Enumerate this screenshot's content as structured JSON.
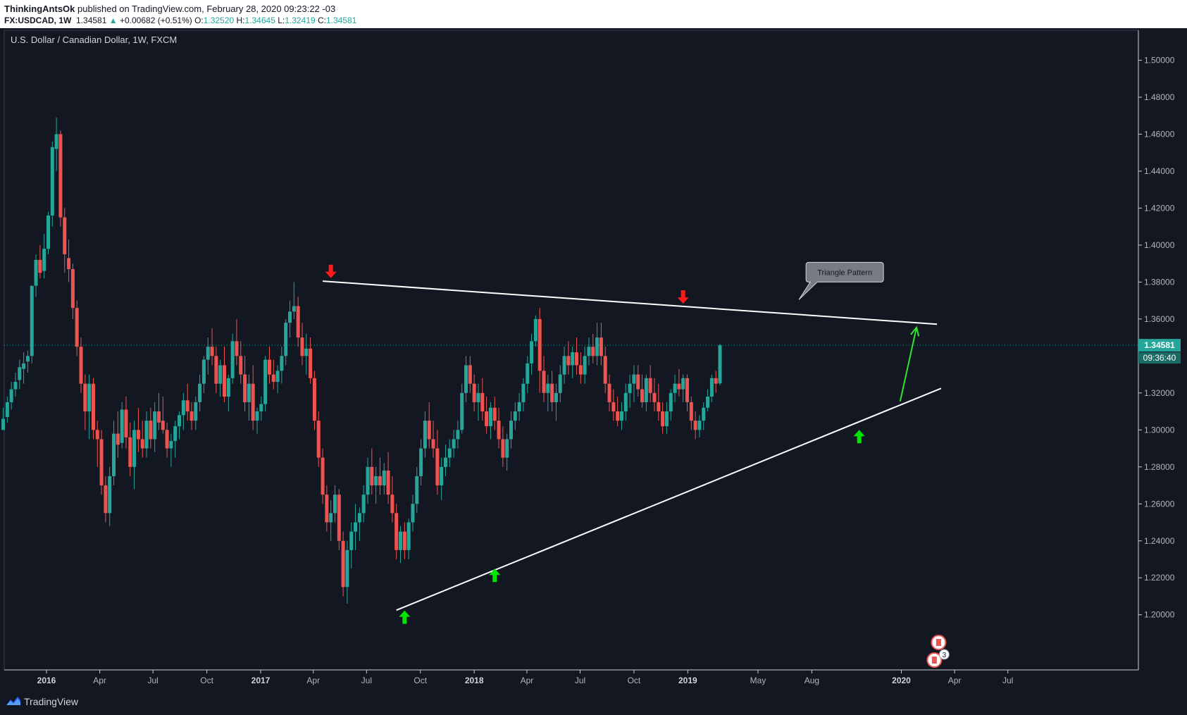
{
  "header": {
    "author": "ThinkingAntsOk",
    "published_text": "published on TradingView.com, February 28, 2020 09:23:22 -03",
    "symbol": "FX:USDCAD, 1W",
    "last": "1.34581",
    "change_arrow": "▲",
    "change": "+0.00682 (+0.51%)",
    "o_label": "O:",
    "o_value": "1.32520",
    "h_label": "H:",
    "h_value": "1.34645",
    "l_label": "L:",
    "l_value": "1.32419",
    "c_label": "C:",
    "c_value": "1.34581"
  },
  "footer": {
    "brand": "TradingView",
    "logo_icon": "tradingview-logo-icon"
  },
  "colors": {
    "background": "#131722",
    "up": "#26a69a",
    "down": "#ef5350",
    "trendline": "#ffffff",
    "target_arrow": "#2ee62e",
    "marker_up": "#00e600",
    "marker_down": "#ff1a1a",
    "axis_text": "#b2b5be"
  },
  "chart_data": {
    "type": "candlestick",
    "title": "U.S. Dollar / Canadian Dollar, 1W, FXCM",
    "ylim": [
      1.18,
      1.5
    ],
    "y_ticks": [
      "1.50000",
      "1.48000",
      "1.46000",
      "1.44000",
      "1.42000",
      "1.40000",
      "1.38000",
      "1.36000",
      "1.34000",
      "1.32000",
      "1.30000",
      "1.28000",
      "1.26000",
      "1.24000",
      "1.22000",
      "1.20000"
    ],
    "x_ticks": [
      {
        "label": "2016",
        "date": "2016-01-01",
        "bold": true
      },
      {
        "label": "Apr",
        "date": "2016-04-01"
      },
      {
        "label": "Jul",
        "date": "2016-07-01"
      },
      {
        "label": "Oct",
        "date": "2016-10-01"
      },
      {
        "label": "2017",
        "date": "2017-01-01",
        "bold": true
      },
      {
        "label": "Apr",
        "date": "2017-04-01"
      },
      {
        "label": "Jul",
        "date": "2017-07-01"
      },
      {
        "label": "Oct",
        "date": "2017-10-01"
      },
      {
        "label": "2018",
        "date": "2018-01-01",
        "bold": true
      },
      {
        "label": "Apr",
        "date": "2018-04-01"
      },
      {
        "label": "Jul",
        "date": "2018-07-01"
      },
      {
        "label": "Oct",
        "date": "2018-10-01"
      },
      {
        "label": "2019",
        "date": "2019-01-01",
        "bold": true
      },
      {
        "label": "May",
        "date": "2019-05-01"
      },
      {
        "label": "Aug",
        "date": "2019-08-01"
      },
      {
        "label": "2020",
        "date": "2020-01-01",
        "bold": true
      },
      {
        "label": "Apr",
        "date": "2020-04-01"
      },
      {
        "label": "Jul",
        "date": "2020-07-01"
      }
    ],
    "price_line": {
      "value": 1.34581,
      "label": "1.34581",
      "countdown": "09:36:40"
    },
    "annotation": {
      "text": "Triangle Pattern",
      "date": "2019-07-10",
      "price": 1.3705
    },
    "trendlines": [
      {
        "name": "upper-trendline",
        "from": {
          "date": "2017-04-17",
          "price": 1.3805
        },
        "to": {
          "date": "2020-03-02",
          "price": 1.3572
        }
      },
      {
        "name": "lower-trendline",
        "from": {
          "date": "2017-08-21",
          "price": 1.2025
        },
        "to": {
          "date": "2020-03-09",
          "price": 1.3225
        }
      }
    ],
    "target_arrow": {
      "from": {
        "date": "2019-12-30",
        "price": 1.3155
      },
      "to": {
        "date": "2020-01-27",
        "price": 1.3555
      }
    },
    "markers": [
      {
        "type": "down",
        "date": "2017-05-01",
        "price": 1.3856
      },
      {
        "type": "down",
        "date": "2018-12-24",
        "price": 1.3717
      },
      {
        "type": "up",
        "date": "2017-09-04",
        "price": 1.1989
      },
      {
        "type": "up",
        "date": "2018-02-05",
        "price": 1.2215
      },
      {
        "type": "up",
        "date": "2019-10-21",
        "price": 1.2966
      }
    ],
    "event_badge": {
      "date": "2020-02-24",
      "count": "3",
      "icon": "canada-flag-icon"
    },
    "candles_start": "2015-10-19",
    "candles_interval_days": 7,
    "candles": [
      [
        1.3,
        1.312,
        1.3,
        1.306
      ],
      [
        1.307,
        1.318,
        1.304,
        1.315
      ],
      [
        1.315,
        1.326,
        1.311,
        1.322
      ],
      [
        1.322,
        1.331,
        1.318,
        1.326
      ],
      [
        1.327,
        1.338,
        1.322,
        1.334
      ],
      [
        1.333,
        1.342,
        1.325,
        1.336
      ],
      [
        1.337,
        1.343,
        1.331,
        1.34
      ],
      [
        1.34,
        1.364,
        1.336,
        1.378
      ],
      [
        1.378,
        1.395,
        1.372,
        1.392
      ],
      [
        1.392,
        1.4,
        1.382,
        1.385
      ],
      [
        1.386,
        1.406,
        1.382,
        1.398
      ],
      [
        1.398,
        1.418,
        1.395,
        1.416
      ],
      [
        1.416,
        1.456,
        1.41,
        1.453
      ],
      [
        1.452,
        1.469,
        1.44,
        1.46
      ],
      [
        1.46,
        1.462,
        1.41,
        1.415
      ],
      [
        1.415,
        1.42,
        1.385,
        1.395
      ],
      [
        1.393,
        1.403,
        1.38,
        1.387
      ],
      [
        1.387,
        1.39,
        1.36,
        1.366
      ],
      [
        1.366,
        1.37,
        1.34,
        1.345
      ],
      [
        1.345,
        1.35,
        1.32,
        1.325
      ],
      [
        1.325,
        1.33,
        1.3,
        1.31
      ],
      [
        1.31,
        1.33,
        1.295,
        1.325
      ],
      [
        1.325,
        1.328,
        1.295,
        1.3
      ],
      [
        1.3,
        1.305,
        1.28,
        1.295
      ],
      [
        1.295,
        1.3,
        1.265,
        1.27
      ],
      [
        1.27,
        1.275,
        1.25,
        1.255
      ],
      [
        1.255,
        1.28,
        1.248,
        1.275
      ],
      [
        1.275,
        1.305,
        1.27,
        1.298
      ],
      [
        1.298,
        1.31,
        1.285,
        1.292
      ],
      [
        1.293,
        1.315,
        1.29,
        1.311
      ],
      [
        1.311,
        1.318,
        1.29,
        1.296
      ],
      [
        1.296,
        1.304,
        1.275,
        1.28
      ],
      [
        1.28,
        1.305,
        1.268,
        1.3
      ],
      [
        1.3,
        1.312,
        1.288,
        1.295
      ],
      [
        1.295,
        1.305,
        1.285,
        1.29
      ],
      [
        1.29,
        1.31,
        1.285,
        1.305
      ],
      [
        1.305,
        1.312,
        1.29,
        1.295
      ],
      [
        1.295,
        1.315,
        1.288,
        1.31
      ],
      [
        1.31,
        1.32,
        1.3,
        1.304
      ],
      [
        1.305,
        1.318,
        1.298,
        1.3
      ],
      [
        1.3,
        1.304,
        1.285,
        1.29
      ],
      [
        1.29,
        1.298,
        1.28,
        1.294
      ],
      [
        1.294,
        1.305,
        1.285,
        1.302
      ],
      [
        1.302,
        1.31,
        1.295,
        1.308
      ],
      [
        1.308,
        1.32,
        1.3,
        1.316
      ],
      [
        1.316,
        1.325,
        1.305,
        1.31
      ],
      [
        1.31,
        1.315,
        1.3,
        1.305
      ],
      [
        1.305,
        1.318,
        1.3,
        1.315
      ],
      [
        1.315,
        1.33,
        1.31,
        1.325
      ],
      [
        1.325,
        1.34,
        1.32,
        1.338
      ],
      [
        1.338,
        1.35,
        1.33,
        1.345
      ],
      [
        1.345,
        1.355,
        1.335,
        1.34
      ],
      [
        1.34,
        1.345,
        1.32,
        1.325
      ],
      [
        1.325,
        1.338,
        1.318,
        1.335
      ],
      [
        1.335,
        1.345,
        1.315,
        1.318
      ],
      [
        1.318,
        1.33,
        1.31,
        1.328
      ],
      [
        1.328,
        1.352,
        1.325,
        1.348
      ],
      [
        1.348,
        1.36,
        1.335,
        1.34
      ],
      [
        1.34,
        1.348,
        1.325,
        1.33
      ],
      [
        1.33,
        1.34,
        1.31,
        1.315
      ],
      [
        1.315,
        1.33,
        1.305,
        1.325
      ],
      [
        1.325,
        1.335,
        1.3,
        1.305
      ],
      [
        1.305,
        1.312,
        1.298,
        1.31
      ],
      [
        1.31,
        1.318,
        1.305,
        1.314
      ],
      [
        1.314,
        1.34,
        1.31,
        1.338
      ],
      [
        1.338,
        1.345,
        1.325,
        1.33
      ],
      [
        1.33,
        1.338,
        1.322,
        1.326
      ],
      [
        1.326,
        1.335,
        1.32,
        1.332
      ],
      [
        1.332,
        1.345,
        1.325,
        1.34
      ],
      [
        1.34,
        1.36,
        1.335,
        1.358
      ],
      [
        1.358,
        1.37,
        1.35,
        1.364
      ],
      [
        1.364,
        1.38,
        1.36,
        1.367
      ],
      [
        1.367,
        1.372,
        1.345,
        1.35
      ],
      [
        1.35,
        1.358,
        1.335,
        1.34
      ],
      [
        1.34,
        1.352,
        1.33,
        1.344
      ],
      [
        1.344,
        1.35,
        1.325,
        1.328
      ],
      [
        1.328,
        1.332,
        1.3,
        1.305
      ],
      [
        1.305,
        1.31,
        1.28,
        1.285
      ],
      [
        1.285,
        1.29,
        1.26,
        1.265
      ],
      [
        1.265,
        1.27,
        1.245,
        1.25
      ],
      [
        1.25,
        1.262,
        1.24,
        1.255
      ],
      [
        1.255,
        1.27,
        1.25,
        1.265
      ],
      [
        1.265,
        1.268,
        1.235,
        1.24
      ],
      [
        1.24,
        1.245,
        1.21,
        1.215
      ],
      [
        1.215,
        1.24,
        1.206,
        1.235
      ],
      [
        1.235,
        1.25,
        1.225,
        1.245
      ],
      [
        1.245,
        1.26,
        1.235,
        1.25
      ],
      [
        1.25,
        1.258,
        1.24,
        1.255
      ],
      [
        1.255,
        1.27,
        1.25,
        1.265
      ],
      [
        1.265,
        1.285,
        1.26,
        1.28
      ],
      [
        1.28,
        1.29,
        1.265,
        1.27
      ],
      [
        1.27,
        1.28,
        1.26,
        1.275
      ],
      [
        1.275,
        1.285,
        1.265,
        1.27
      ],
      [
        1.27,
        1.282,
        1.265,
        1.278
      ],
      [
        1.278,
        1.288,
        1.26,
        1.265
      ],
      [
        1.265,
        1.275,
        1.25,
        1.255
      ],
      [
        1.255,
        1.26,
        1.23,
        1.235
      ],
      [
        1.235,
        1.248,
        1.228,
        1.245
      ],
      [
        1.245,
        1.25,
        1.23,
        1.235
      ],
      [
        1.235,
        1.252,
        1.23,
        1.25
      ],
      [
        1.25,
        1.265,
        1.245,
        1.26
      ],
      [
        1.26,
        1.28,
        1.255,
        1.275
      ],
      [
        1.275,
        1.295,
        1.27,
        1.29
      ],
      [
        1.29,
        1.31,
        1.285,
        1.305
      ],
      [
        1.305,
        1.315,
        1.29,
        1.295
      ],
      [
        1.295,
        1.305,
        1.285,
        1.29
      ],
      [
        1.29,
        1.3,
        1.265,
        1.27
      ],
      [
        1.27,
        1.285,
        1.262,
        1.28
      ],
      [
        1.28,
        1.292,
        1.275,
        1.285
      ],
      [
        1.285,
        1.295,
        1.28,
        1.29
      ],
      [
        1.29,
        1.3,
        1.285,
        1.295
      ],
      [
        1.295,
        1.305,
        1.29,
        1.3
      ],
      [
        1.3,
        1.325,
        1.298,
        1.32
      ],
      [
        1.32,
        1.34,
        1.315,
        1.335
      ],
      [
        1.335,
        1.34,
        1.32,
        1.325
      ],
      [
        1.325,
        1.33,
        1.31,
        1.315
      ],
      [
        1.315,
        1.325,
        1.305,
        1.32
      ],
      [
        1.32,
        1.328,
        1.305,
        1.31
      ],
      [
        1.31,
        1.318,
        1.298,
        1.302
      ],
      [
        1.302,
        1.315,
        1.295,
        1.312
      ],
      [
        1.312,
        1.318,
        1.3,
        1.305
      ],
      [
        1.305,
        1.312,
        1.29,
        1.295
      ],
      [
        1.295,
        1.302,
        1.28,
        1.285
      ],
      [
        1.285,
        1.298,
        1.278,
        1.295
      ],
      [
        1.295,
        1.31,
        1.29,
        1.305
      ],
      [
        1.305,
        1.315,
        1.3,
        1.31
      ],
      [
        1.31,
        1.32,
        1.305,
        1.315
      ],
      [
        1.315,
        1.328,
        1.31,
        1.325
      ],
      [
        1.325,
        1.34,
        1.32,
        1.336
      ],
      [
        1.336,
        1.352,
        1.33,
        1.348
      ],
      [
        1.348,
        1.362,
        1.345,
        1.36
      ],
      [
        1.36,
        1.366,
        1.32,
        1.332
      ],
      [
        1.332,
        1.34,
        1.315,
        1.32
      ],
      [
        1.32,
        1.33,
        1.31,
        1.325
      ],
      [
        1.325,
        1.332,
        1.31,
        1.315
      ],
      [
        1.315,
        1.325,
        1.305,
        1.32
      ],
      [
        1.32,
        1.335,
        1.315,
        1.33
      ],
      [
        1.33,
        1.345,
        1.325,
        1.34
      ],
      [
        1.34,
        1.348,
        1.33,
        1.335
      ],
      [
        1.335,
        1.345,
        1.328,
        1.342
      ],
      [
        1.342,
        1.35,
        1.33,
        1.335
      ],
      [
        1.335,
        1.342,
        1.325,
        1.33
      ],
      [
        1.33,
        1.345,
        1.325,
        1.34
      ],
      [
        1.34,
        1.35,
        1.335,
        1.345
      ],
      [
        1.345,
        1.352,
        1.336,
        1.34
      ],
      [
        1.34,
        1.358,
        1.335,
        1.35
      ],
      [
        1.35,
        1.358,
        1.335,
        1.34
      ],
      [
        1.34,
        1.345,
        1.32,
        1.325
      ],
      [
        1.325,
        1.33,
        1.31,
        1.315
      ],
      [
        1.315,
        1.322,
        1.305,
        1.31
      ],
      [
        1.31,
        1.318,
        1.302,
        1.305
      ],
      [
        1.305,
        1.315,
        1.3,
        1.31
      ],
      [
        1.31,
        1.325,
        1.305,
        1.32
      ],
      [
        1.32,
        1.33,
        1.312,
        1.325
      ],
      [
        1.325,
        1.335,
        1.315,
        1.33
      ],
      [
        1.33,
        1.335,
        1.318,
        1.322
      ],
      [
        1.322,
        1.33,
        1.312,
        1.315
      ],
      [
        1.315,
        1.33,
        1.31,
        1.328
      ],
      [
        1.328,
        1.335,
        1.315,
        1.32
      ],
      [
        1.32,
        1.328,
        1.31,
        1.315
      ],
      [
        1.315,
        1.325,
        1.305,
        1.31
      ],
      [
        1.31,
        1.315,
        1.298,
        1.302
      ],
      [
        1.302,
        1.315,
        1.298,
        1.31
      ],
      [
        1.31,
        1.322,
        1.305,
        1.32
      ],
      [
        1.32,
        1.33,
        1.315,
        1.325
      ],
      [
        1.325,
        1.333,
        1.318,
        1.322
      ],
      [
        1.322,
        1.33,
        1.315,
        1.328
      ],
      [
        1.328,
        1.33,
        1.31,
        1.315
      ],
      [
        1.315,
        1.318,
        1.3,
        1.305
      ],
      [
        1.305,
        1.31,
        1.295,
        1.3
      ],
      [
        1.3,
        1.308,
        1.296,
        1.305
      ],
      [
        1.305,
        1.315,
        1.3,
        1.312
      ],
      [
        1.312,
        1.322,
        1.31,
        1.318
      ],
      [
        1.318,
        1.33,
        1.315,
        1.328
      ],
      [
        1.328,
        1.332,
        1.32,
        1.325
      ],
      [
        1.3252,
        1.34645,
        1.32419,
        1.34581
      ]
    ]
  }
}
